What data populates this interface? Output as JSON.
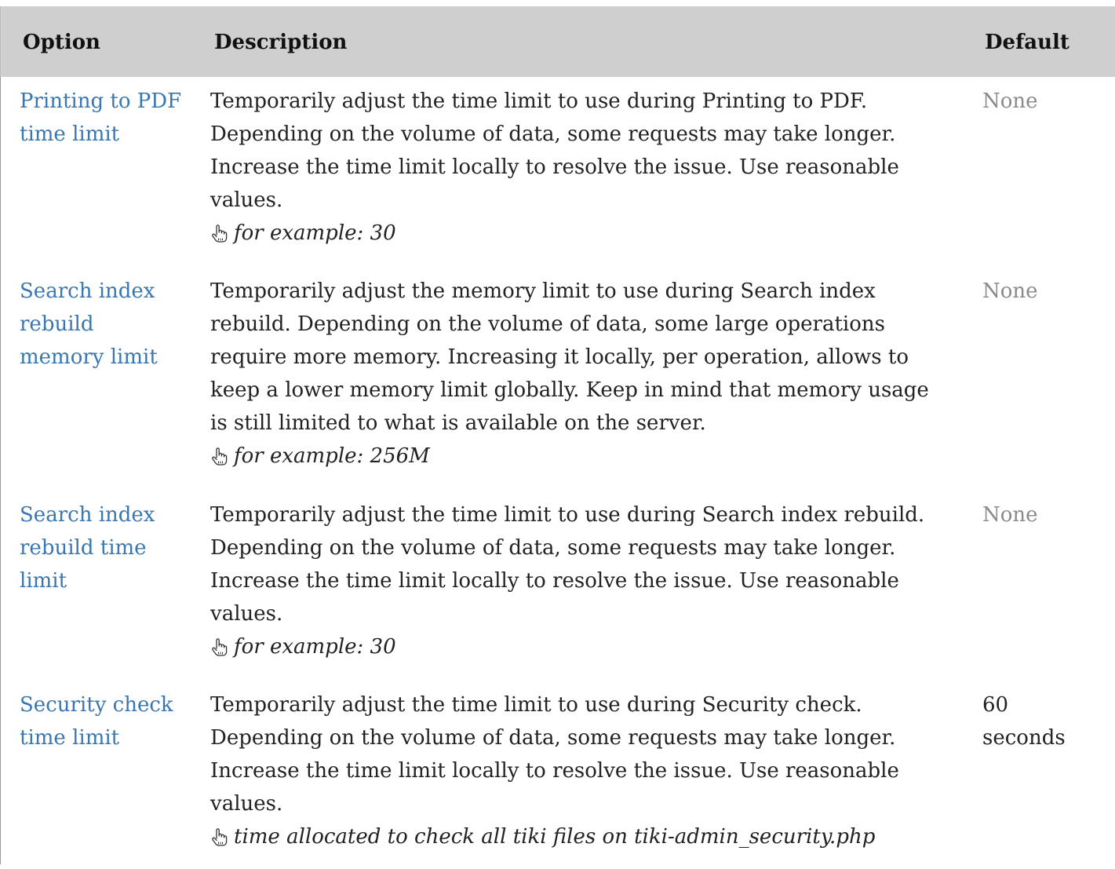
{
  "header": {
    "option": "Option",
    "description": "Description",
    "default": "Default"
  },
  "rows": [
    {
      "option_lines": [
        "Printing to PDF",
        "time limit"
      ],
      "description_lines": [
        "Temporarily adjust the time limit to use during Printing to PDF.",
        "Depending on the volume of data, some requests may take longer.",
        "Increase the time limit locally to resolve the issue. Use reasonable",
        "values."
      ],
      "hint": "for example: 30",
      "default_lines": [
        "None"
      ],
      "default_is_none": true
    },
    {
      "option_lines": [
        "Search index",
        "rebuild",
        "memory limit"
      ],
      "description_lines": [
        "Temporarily adjust the memory limit to use during Search index",
        "rebuild. Depending on the volume of data, some large operations",
        "require more memory. Increasing it locally, per operation, allows to",
        "keep a lower memory limit globally. Keep in mind that memory usage",
        "is still limited to what is available on the server."
      ],
      "hint": "for example: 256M",
      "default_lines": [
        "None"
      ],
      "default_is_none": true
    },
    {
      "option_lines": [
        "Search index",
        "rebuild time",
        "limit"
      ],
      "description_lines": [
        "Temporarily adjust the time limit to use during Search index rebuild.",
        "Depending on the volume of data, some requests may take longer.",
        "Increase the time limit locally to resolve the issue. Use reasonable",
        "values."
      ],
      "hint": "for example: 30",
      "default_lines": [
        "None"
      ],
      "default_is_none": true
    },
    {
      "option_lines": [
        "Security check",
        "time limit"
      ],
      "description_lines": [
        "Temporarily adjust the time limit to use during Security check.",
        "Depending on the volume of data, some requests may take longer.",
        "Increase the time limit locally to resolve the issue. Use reasonable",
        "values."
      ],
      "hint": "time allocated to check all tiki files on tiki-admin_security.php",
      "default_lines": [
        "60",
        "seconds"
      ],
      "default_is_none": false
    }
  ],
  "colors": {
    "header_bg": "#cfcfcf",
    "link": "#3a77b0",
    "default_none": "#8a8a8a",
    "text": "#222222"
  },
  "icons": {
    "hint": "pointing-hand-icon"
  }
}
